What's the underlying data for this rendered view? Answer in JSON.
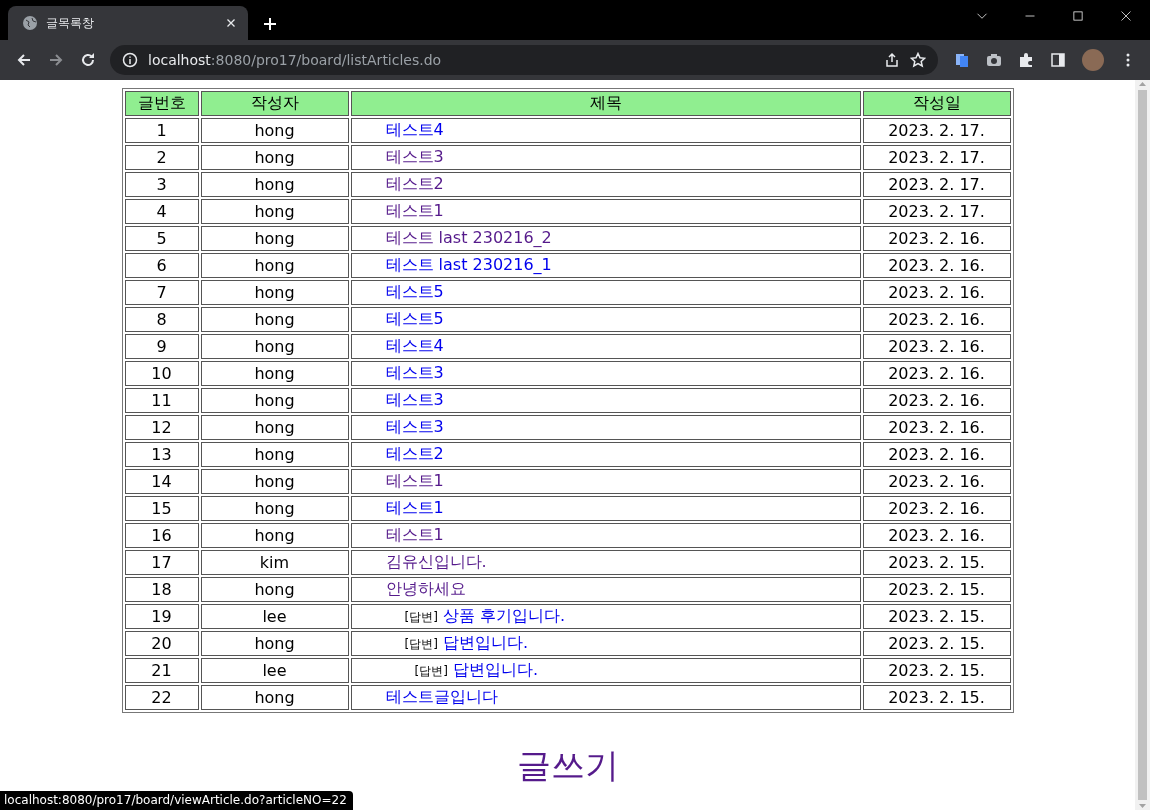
{
  "browser": {
    "tab_title": "글목록창",
    "url_host": "localhost",
    "url_path": ":8080/pro17/board/listArticles.do"
  },
  "table": {
    "columns": [
      "글번호",
      "작성자",
      "제목",
      "작성일"
    ],
    "rows": [
      {
        "no": "1",
        "author": "hong",
        "title": "테스트4",
        "visited": false,
        "date": "2023. 2. 17."
      },
      {
        "no": "2",
        "author": "hong",
        "title": "테스트3",
        "visited": true,
        "date": "2023. 2. 17."
      },
      {
        "no": "3",
        "author": "hong",
        "title": "테스트2",
        "visited": true,
        "date": "2023. 2. 17."
      },
      {
        "no": "4",
        "author": "hong",
        "title": "테스트1",
        "visited": true,
        "date": "2023. 2. 17."
      },
      {
        "no": "5",
        "author": "hong",
        "title": "테스트 last 230216_2",
        "visited": true,
        "date": "2023. 2. 16."
      },
      {
        "no": "6",
        "author": "hong",
        "title": "테스트 last 230216_1",
        "visited": false,
        "date": "2023. 2. 16."
      },
      {
        "no": "7",
        "author": "hong",
        "title": "테스트5",
        "visited": false,
        "date": "2023. 2. 16."
      },
      {
        "no": "8",
        "author": "hong",
        "title": "테스트5",
        "visited": false,
        "date": "2023. 2. 16."
      },
      {
        "no": "9",
        "author": "hong",
        "title": "테스트4",
        "visited": false,
        "date": "2023. 2. 16."
      },
      {
        "no": "10",
        "author": "hong",
        "title": "테스트3",
        "visited": false,
        "date": "2023. 2. 16."
      },
      {
        "no": "11",
        "author": "hong",
        "title": "테스트3",
        "visited": false,
        "date": "2023. 2. 16."
      },
      {
        "no": "12",
        "author": "hong",
        "title": "테스트3",
        "visited": false,
        "date": "2023. 2. 16."
      },
      {
        "no": "13",
        "author": "hong",
        "title": "테스트2",
        "visited": false,
        "date": "2023. 2. 16."
      },
      {
        "no": "14",
        "author": "hong",
        "title": "테스트1",
        "visited": true,
        "date": "2023. 2. 16."
      },
      {
        "no": "15",
        "author": "hong",
        "title": "테스트1",
        "visited": false,
        "date": "2023. 2. 16."
      },
      {
        "no": "16",
        "author": "hong",
        "title": "테스트1",
        "visited": true,
        "date": "2023. 2. 16."
      },
      {
        "no": "17",
        "author": "kim",
        "title": "김유신입니다.",
        "visited": true,
        "date": "2023. 2. 15."
      },
      {
        "no": "18",
        "author": "hong",
        "title": "안녕하세요",
        "visited": true,
        "date": "2023. 2. 15.",
        "children": [
          {
            "no": "19",
            "author": "lee",
            "reply_label": "[답변]",
            "title": "상품 후기입니다.",
            "visited": false,
            "date": "2023. 2. 15."
          },
          {
            "no": "20",
            "author": "hong",
            "reply_label": "[답변]",
            "title": "답변입니다.",
            "visited": false,
            "date": "2023. 2. 15.",
            "children": [
              {
                "no": "21",
                "author": "lee",
                "reply_label": "[답변]",
                "title": "답변입니다.",
                "visited": false,
                "date": "2023. 2. 15."
              }
            ]
          }
        ]
      },
      {
        "no": "22",
        "author": "hong",
        "title": "테스트글입니다",
        "visited": false,
        "date": "2023. 2. 15."
      }
    ]
  },
  "write_link": {
    "label": "글쓰기",
    "visited": true
  },
  "status_bar": "localhost:8080/pro17/board/viewArticle.do?articleNO=22"
}
